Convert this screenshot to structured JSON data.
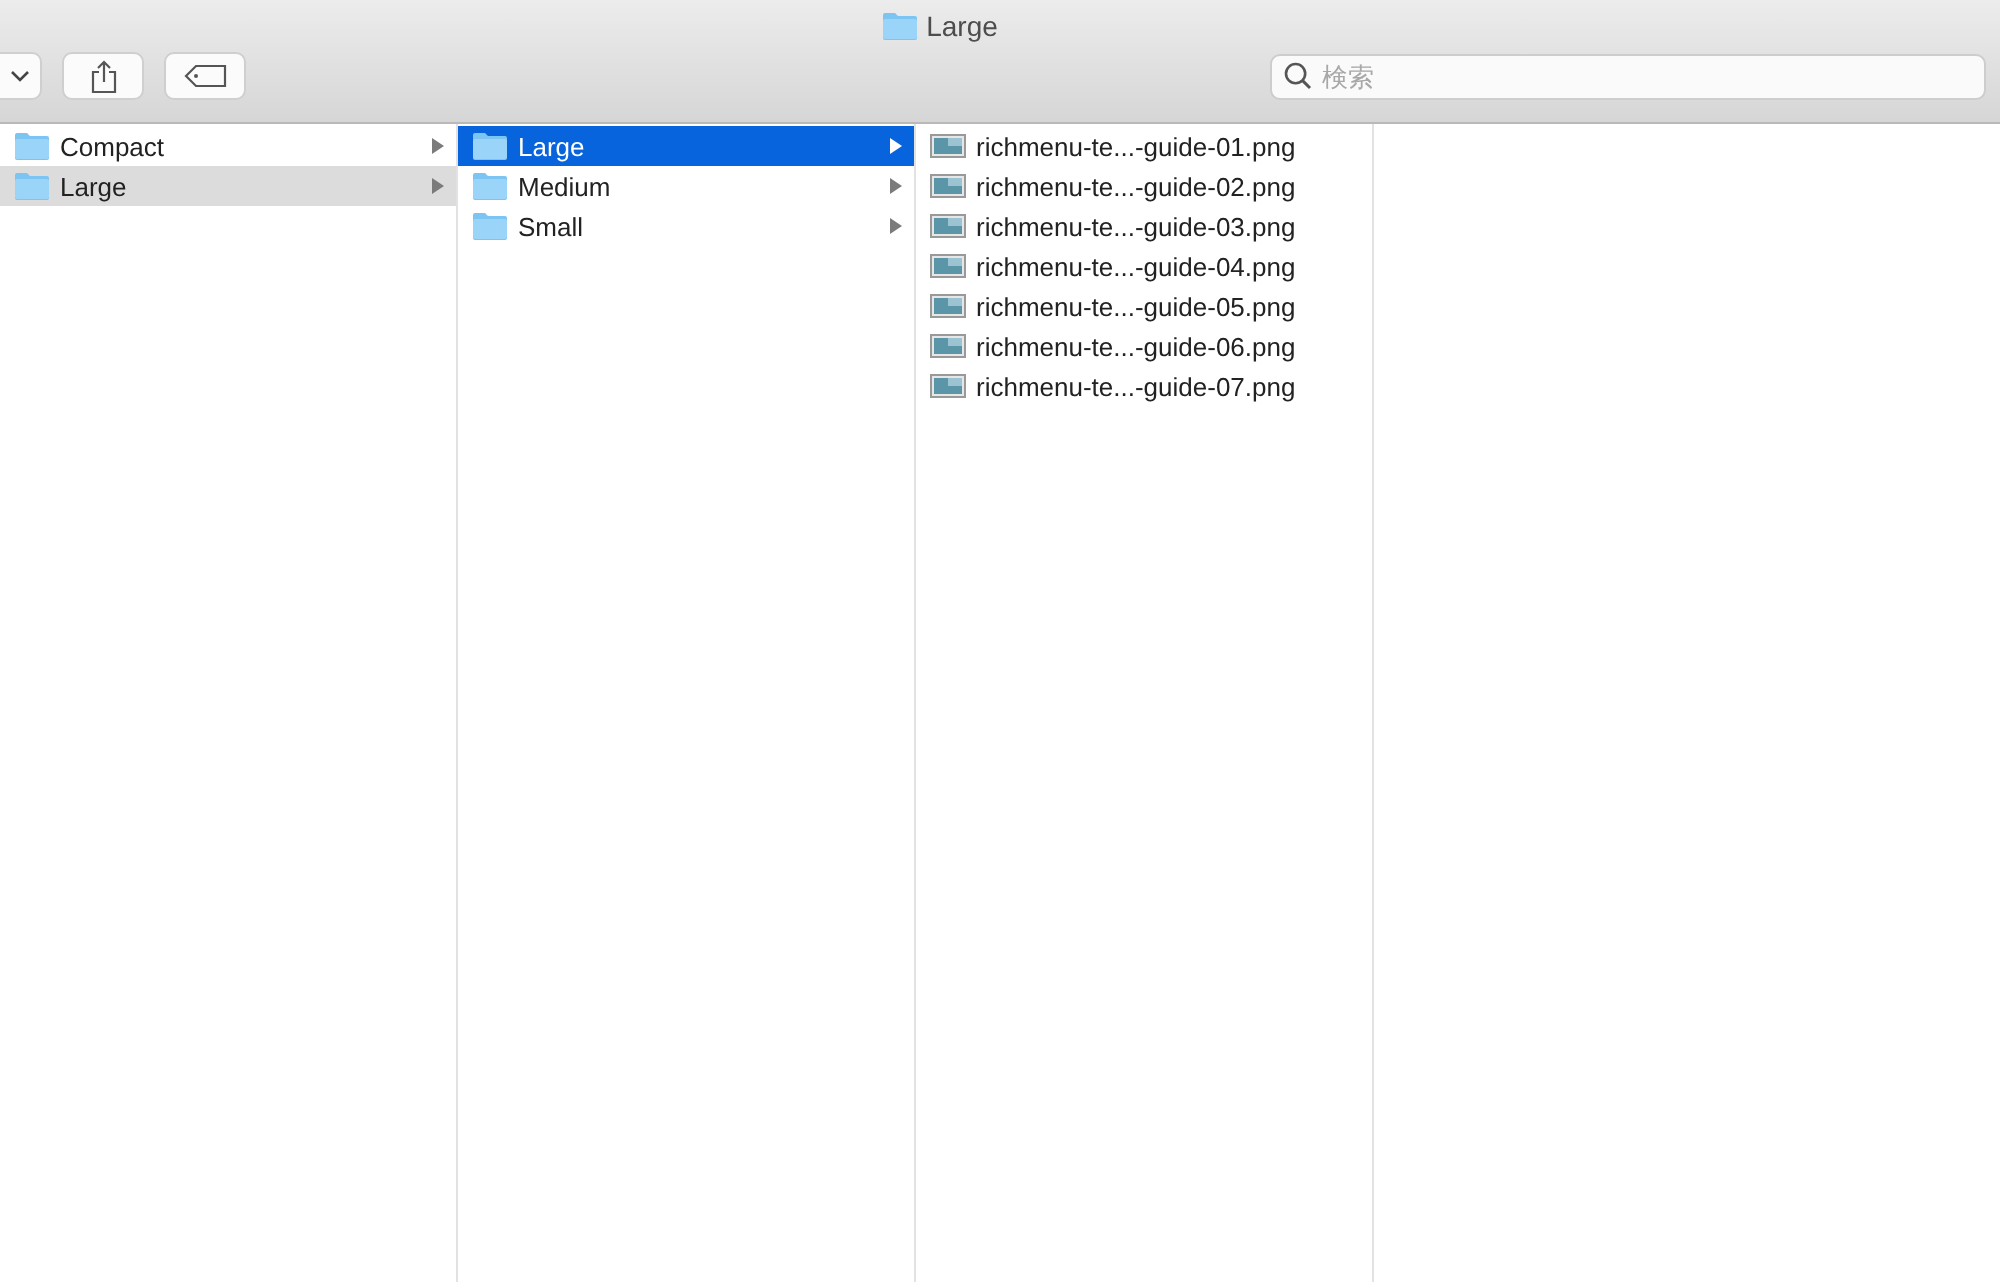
{
  "window": {
    "title": "Large"
  },
  "search": {
    "placeholder": "検索"
  },
  "columns": [
    {
      "items": [
        {
          "label": "Compact",
          "kind": "folder",
          "selected": false
        },
        {
          "label": "Large",
          "kind": "folder",
          "selected": true
        }
      ]
    },
    {
      "items": [
        {
          "label": "Large",
          "kind": "folder",
          "selected": true
        },
        {
          "label": "Medium",
          "kind": "folder",
          "selected": false
        },
        {
          "label": "Small",
          "kind": "folder",
          "selected": false
        }
      ]
    },
    {
      "items": [
        {
          "label": "richmenu-te...-guide-01.png",
          "kind": "image",
          "selected": false
        },
        {
          "label": "richmenu-te...-guide-02.png",
          "kind": "image",
          "selected": false
        },
        {
          "label": "richmenu-te...-guide-03.png",
          "kind": "image",
          "selected": false
        },
        {
          "label": "richmenu-te...-guide-04.png",
          "kind": "image",
          "selected": false
        },
        {
          "label": "richmenu-te...-guide-05.png",
          "kind": "image",
          "selected": false
        },
        {
          "label": "richmenu-te...-guide-06.png",
          "kind": "image",
          "selected": false
        },
        {
          "label": "richmenu-te...-guide-07.png",
          "kind": "image",
          "selected": false
        }
      ]
    }
  ]
}
